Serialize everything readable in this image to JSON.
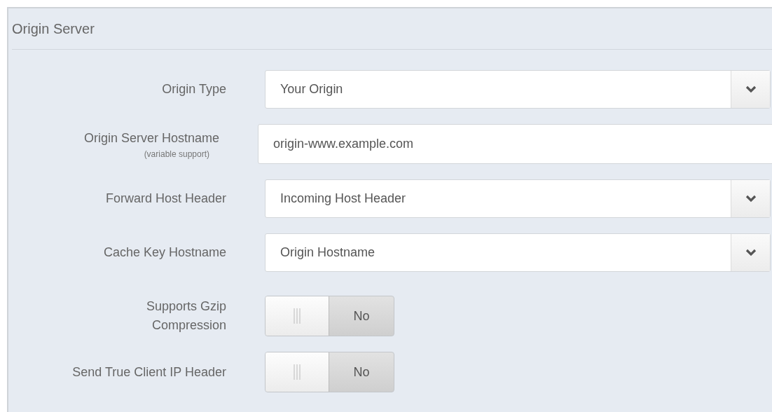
{
  "panel": {
    "title": "Origin Server"
  },
  "fields": [
    {
      "kind": "select",
      "label": "Origin Type",
      "value": "Your Origin"
    },
    {
      "kind": "text",
      "label": "Origin Server Hostname",
      "sublabel": "(variable support)",
      "value": "origin-www.example.com"
    },
    {
      "kind": "select",
      "label": "Forward Host Header",
      "value": "Incoming Host Header"
    },
    {
      "kind": "select",
      "label": "Cache Key Hostname",
      "value": "Origin Hostname"
    },
    {
      "kind": "toggle",
      "label": "Supports Gzip Compression",
      "on": false,
      "value": "No"
    },
    {
      "kind": "toggle",
      "label": "Send True Client IP Header",
      "on": false,
      "value": "No"
    }
  ]
}
